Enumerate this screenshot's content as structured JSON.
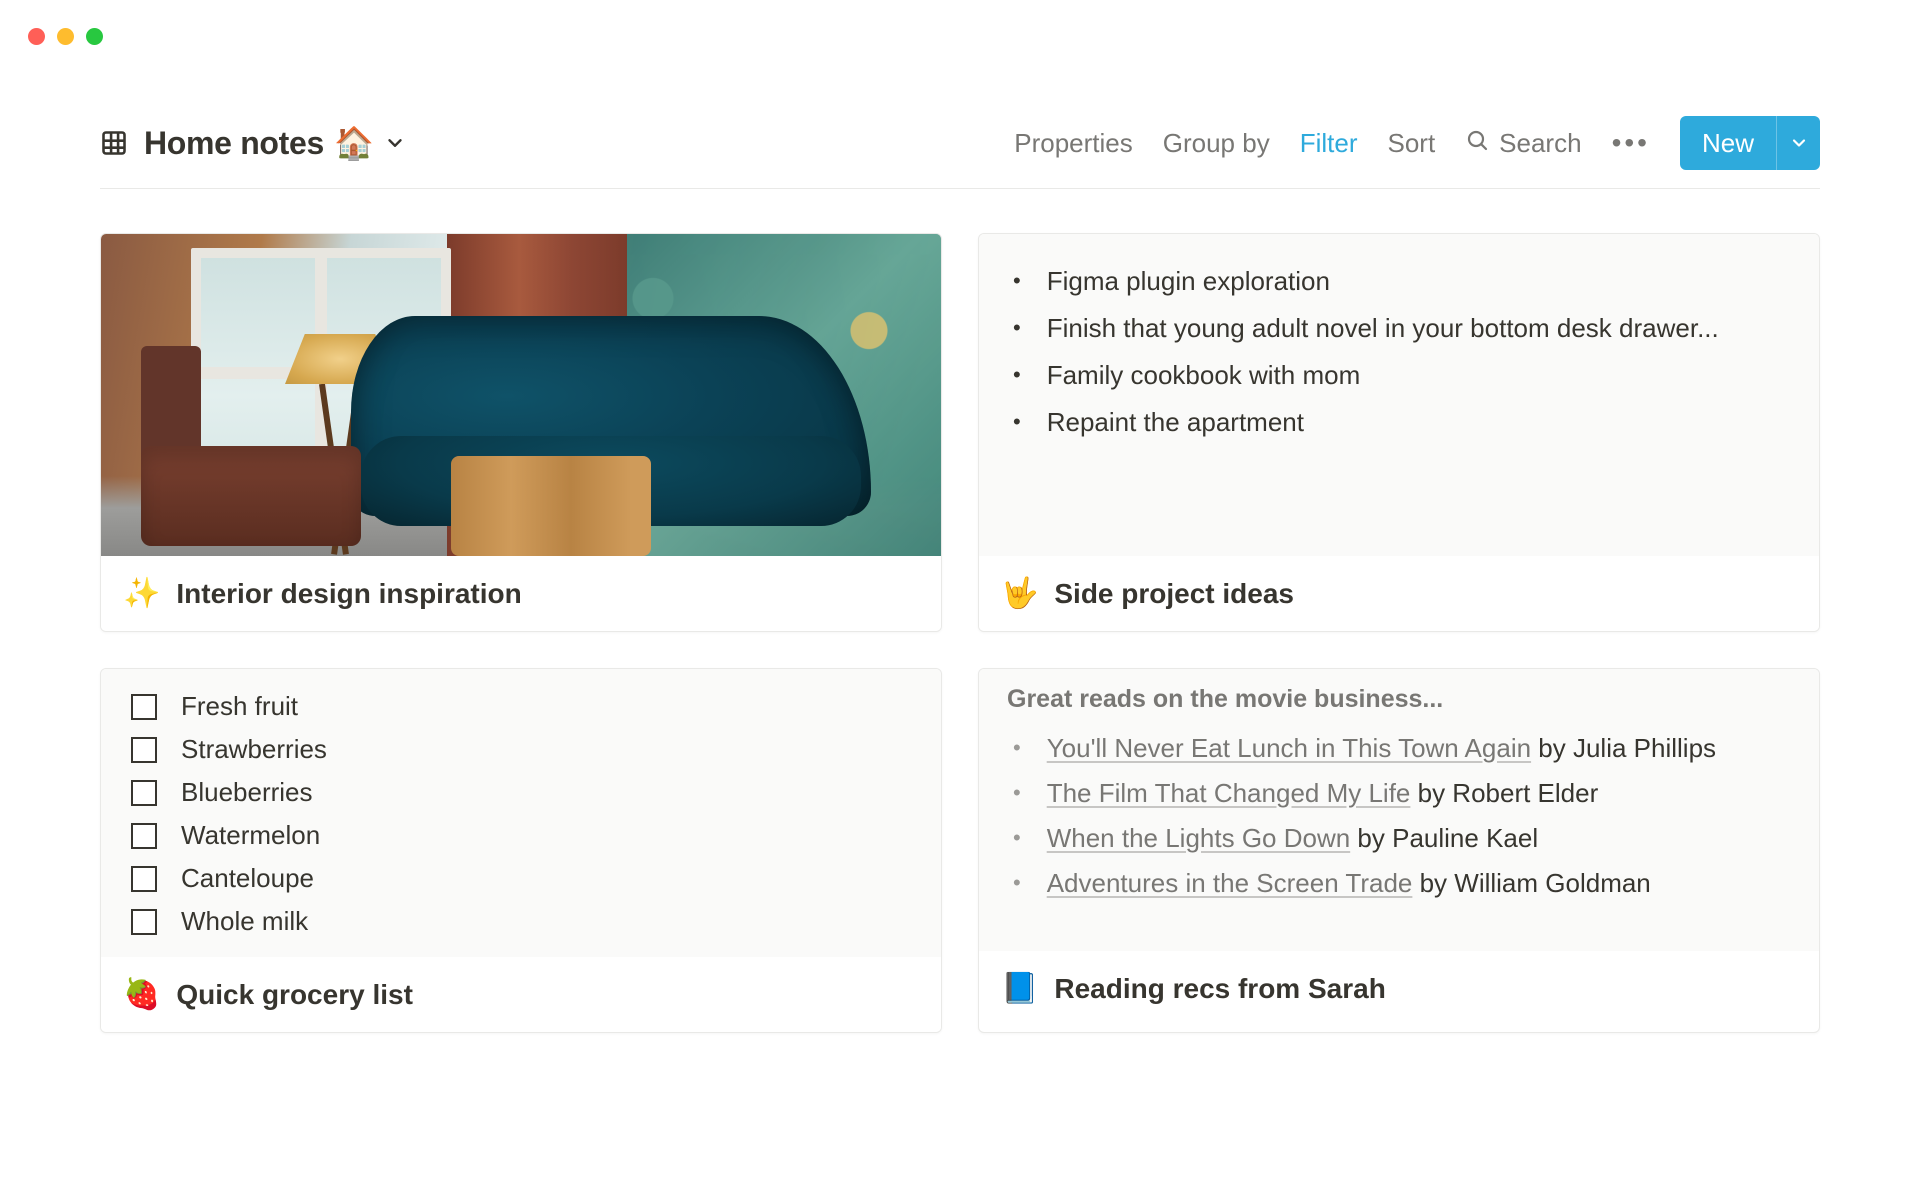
{
  "window": {
    "system": "mac"
  },
  "view": {
    "icon": "grid",
    "title": "Home notes",
    "emoji": "🏠"
  },
  "toolbar": {
    "properties": "Properties",
    "group_by": "Group by",
    "filter": "Filter",
    "sort": "Sort",
    "search": "Search",
    "new": "New"
  },
  "cards": {
    "interior": {
      "emoji": "✨",
      "title": "Interior design inspiration"
    },
    "side_projects": {
      "emoji": "🤟",
      "title": "Side project ideas",
      "items": [
        "Figma plugin exploration",
        "Finish that young adult novel in your bottom desk drawer...",
        "Family cookbook with mom",
        "Repaint the apartment"
      ]
    },
    "grocery": {
      "emoji": "🍓",
      "title": "Quick grocery list",
      "items": [
        "Fresh fruit",
        "Strawberries",
        "Blueberries",
        "Watermelon",
        "Canteloupe",
        "Whole milk"
      ]
    },
    "reading": {
      "emoji": "📘",
      "title": "Reading recs from Sarah",
      "heading": "Great reads on the movie business...",
      "books": [
        {
          "title": "You'll Never Eat Lunch in This Town Again",
          "by": " by Julia Phillips"
        },
        {
          "title": "The Film That Changed My Life",
          "by": " by Robert Elder"
        },
        {
          "title": "When the Lights Go Down",
          "by": " by Pauline Kael"
        },
        {
          "title": "Adventures in the Screen Trade",
          "by": " by William Goldman"
        }
      ]
    }
  }
}
